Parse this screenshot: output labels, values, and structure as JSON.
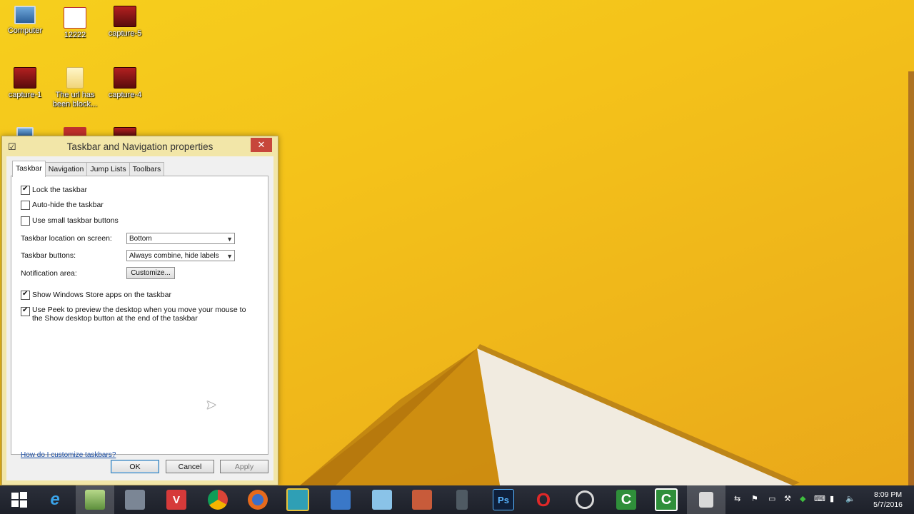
{
  "desktop": {
    "icons": [
      {
        "label": "Computer"
      },
      {
        "label": "12222"
      },
      {
        "label": "capture-5"
      },
      {
        "label": "capture-1"
      },
      {
        "label": "The url has been block..."
      },
      {
        "label": "capture-4"
      }
    ]
  },
  "dialog": {
    "title": "Taskbar and Navigation properties",
    "close_glyph": "✕",
    "tabs": [
      "Taskbar",
      "Navigation",
      "Jump Lists",
      "Toolbars"
    ],
    "active_tab": "Taskbar",
    "options": {
      "lock_taskbar": {
        "label": "Lock the taskbar",
        "checked": true
      },
      "auto_hide": {
        "label": "Auto-hide the taskbar",
        "checked": false
      },
      "small_buttons": {
        "label": "Use small taskbar buttons",
        "checked": false
      },
      "store_apps": {
        "label": "Show Windows Store apps on the taskbar",
        "checked": true
      },
      "peek": {
        "label": "Use Peek to preview the desktop when you move your mouse to the Show desktop button at the end of the taskbar",
        "checked": true
      }
    },
    "location_label": "Taskbar location on screen:",
    "location_value": "Bottom",
    "buttons_label": "Taskbar buttons:",
    "buttons_value": "Always combine, hide labels",
    "notification_label": "Notification area:",
    "customize_label": "Customize...",
    "help_link": "How do I customize taskbars?",
    "ok_label": "OK",
    "cancel_label": "Cancel",
    "apply_label": "Apply"
  },
  "taskbar": {
    "apps": [
      {
        "icon": "windows-start-icon"
      },
      {
        "icon": "internet-explorer-icon",
        "glyph": "e"
      },
      {
        "icon": "file-explorer-icon"
      },
      {
        "icon": "folder-icon"
      },
      {
        "icon": "vivaldi-icon",
        "glyph": "V"
      },
      {
        "icon": "chrome-icon"
      },
      {
        "icon": "firefox-icon"
      },
      {
        "icon": "photo-app-icon"
      },
      {
        "icon": "network-app-icon"
      },
      {
        "icon": "bird-app-icon"
      },
      {
        "icon": "paint-app-icon"
      },
      {
        "icon": "phone-app-icon"
      },
      {
        "icon": "photoshop-icon",
        "glyph": "Ps"
      },
      {
        "icon": "opera-icon",
        "glyph": "O"
      },
      {
        "icon": "sync-app-icon"
      },
      {
        "icon": "camtasia-icon",
        "glyph": "C"
      },
      {
        "icon": "camtasia-recorder-icon",
        "glyph": "C"
      },
      {
        "icon": "settings-window-icon"
      }
    ],
    "time": "8:09 PM",
    "date": "5/7/2016"
  },
  "colors": {
    "desktop_yellow": "#f4c21a",
    "taskbar_dark": "#22252e",
    "close_red": "#c7463b",
    "dialog_frame": "#f2e6a8"
  }
}
